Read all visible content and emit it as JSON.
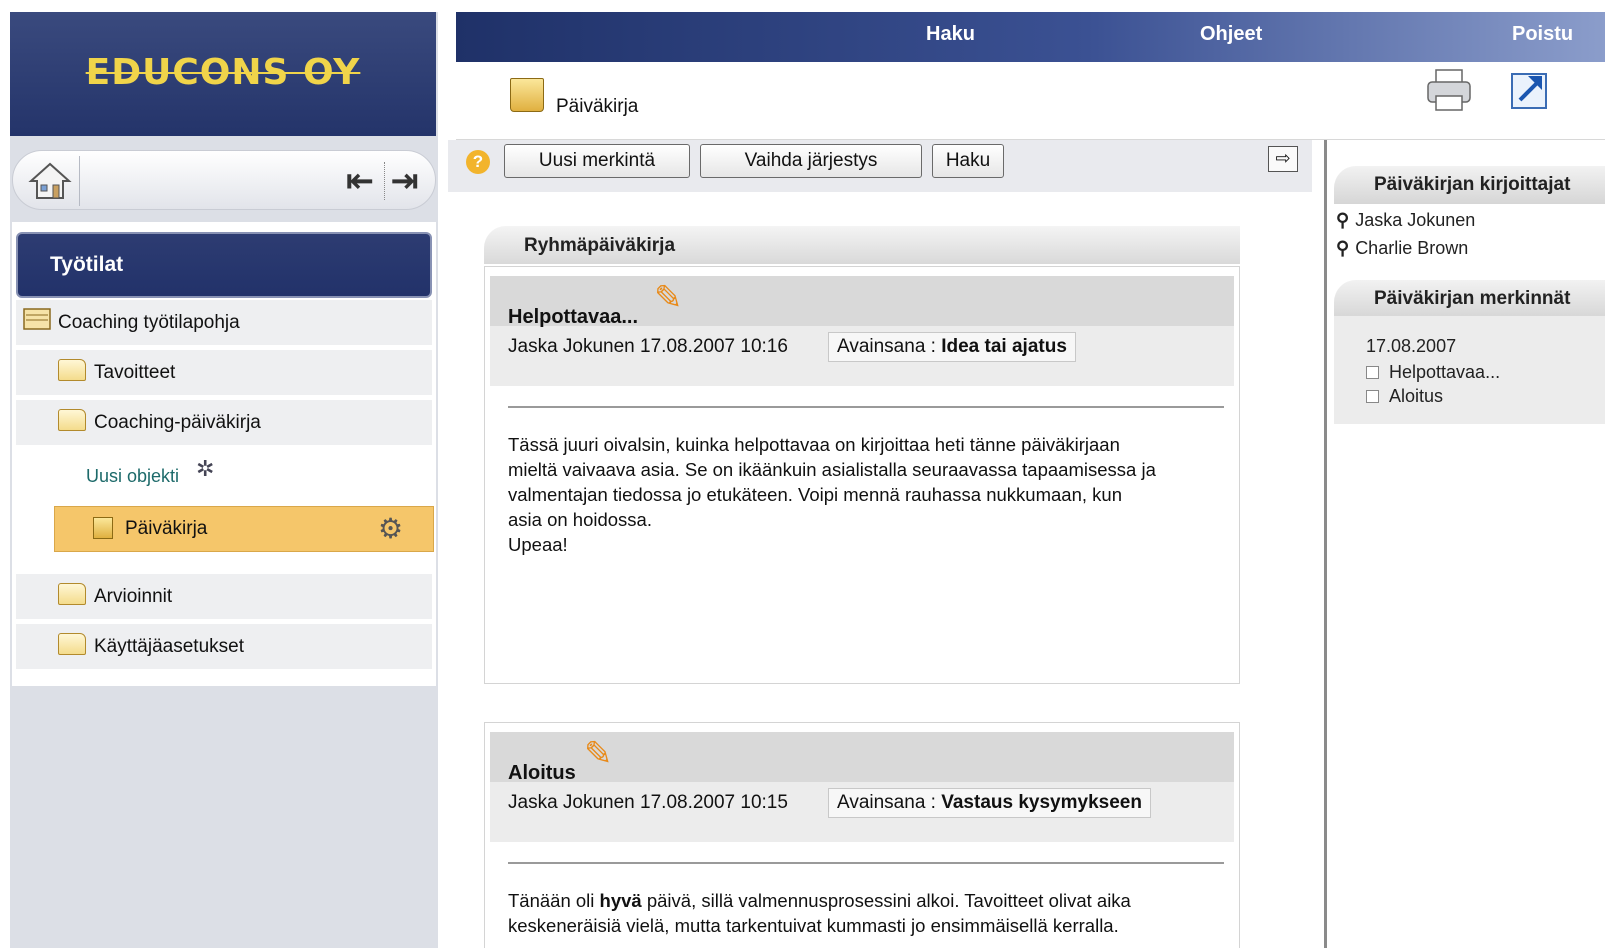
{
  "app": {
    "logo_text": "EDUCONS OY"
  },
  "header": {
    "nav": {
      "search": "Haku",
      "help": "Ohjeet",
      "logout": "Poistu"
    },
    "page_title": "Päiväkirja"
  },
  "sidebar": {
    "title": "Työtilat",
    "workspace": "Coaching työtilapohja",
    "items": [
      {
        "label": "Tavoitteet"
      },
      {
        "label": "Coaching-päiväkirja"
      }
    ],
    "new_object": "Uusi objekti",
    "selected": "Päiväkirja",
    "items_bottom": [
      {
        "label": "Arvioinnit"
      },
      {
        "label": "Käyttäjäasetukset"
      }
    ]
  },
  "toolbar": {
    "new_entry": "Uusi merkintä",
    "change_order": "Vaihda järjestys",
    "search": "Haku"
  },
  "diary": {
    "group_title": "Ryhmäpäiväkirja",
    "entries": [
      {
        "title": "Helpottavaa...",
        "meta": "Jaska Jokunen 17.08.2007 10:16",
        "keyword_label": "Avainsana :",
        "keyword": "Idea tai ajatus",
        "body_lines": [
          "Tässä juuri oivalsin, kuinka helpottavaa on kirjoittaa heti tänne päiväkirjaan",
          "mieltä vaivaava asia. Se on ikäänkuin asialistalla seuraavassa tapaamisessa ja",
          "valmentajan tiedossa jo etukäteen. Voipi mennä rauhassa nukkumaan, kun",
          "asia on hoidossa.",
          "Upeaa!"
        ]
      },
      {
        "title": "Aloitus",
        "meta": "Jaska Jokunen 17.08.2007 10:15",
        "keyword_label": "Avainsana :",
        "keyword": "Vastaus kysymykseen",
        "body_line1_pre": "Tänään oli ",
        "body_line1_bold": "hyvä",
        "body_line1_post": " päivä, sillä valmennusprosessini alkoi. Tavoitteet olivat aika",
        "body_line2": "keskeneräisiä vielä, mutta tarkentuivat kummasti jo ensimmäisellä kerralla."
      }
    ]
  },
  "right_panel": {
    "writers_title": "Päiväkirjan kirjoittajat",
    "writers": [
      "Jaska Jokunen",
      "Charlie Brown"
    ],
    "entries_title": "Päiväkirjan merkinnät",
    "entry_date": "17.08.2007",
    "entry_links": [
      "Helpottavaa...",
      "Aloitus"
    ]
  }
}
